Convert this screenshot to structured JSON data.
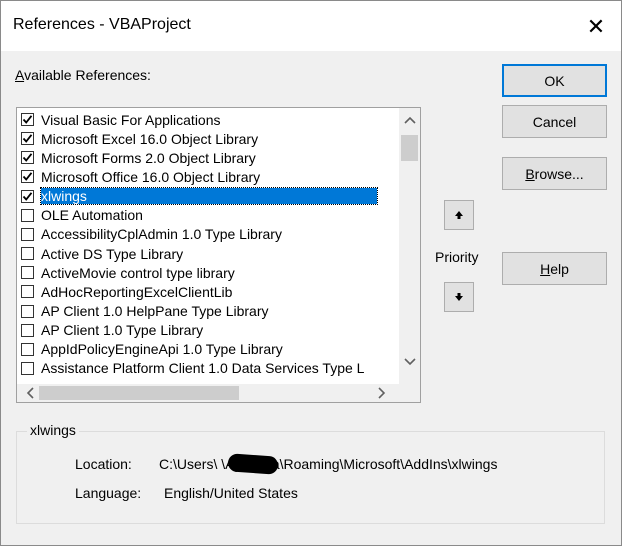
{
  "window": {
    "title": "References - VBAProject",
    "close_glyph": "✕"
  },
  "available_label": {
    "underlined": "A",
    "rest": "vailable References:"
  },
  "references": [
    {
      "label": "Visual Basic For Applications",
      "checked": true,
      "selected": false
    },
    {
      "label": "Microsoft Excel 16.0 Object Library",
      "checked": true,
      "selected": false
    },
    {
      "label": "Microsoft Forms 2.0 Object Library",
      "checked": true,
      "selected": false
    },
    {
      "label": "Microsoft Office 16.0 Object Library",
      "checked": true,
      "selected": false
    },
    {
      "label": "xlwings",
      "checked": true,
      "selected": true
    },
    {
      "label": "OLE Automation",
      "checked": false,
      "selected": false
    },
    {
      "label": "AccessibilityCplAdmin 1.0 Type Library",
      "checked": false,
      "selected": false
    },
    {
      "label": "Active DS Type Library",
      "checked": false,
      "selected": false
    },
    {
      "label": "ActiveMovie control type library",
      "checked": false,
      "selected": false
    },
    {
      "label": "AdHocReportingExcelClientLib",
      "checked": false,
      "selected": false
    },
    {
      "label": "AP Client 1.0 HelpPane Type Library",
      "checked": false,
      "selected": false
    },
    {
      "label": "AP Client 1.0 Type Library",
      "checked": false,
      "selected": false
    },
    {
      "label": "AppIdPolicyEngineApi 1.0 Type Library",
      "checked": false,
      "selected": false
    },
    {
      "label": "Assistance Platform Client 1.0 Data Services Type L",
      "checked": false,
      "selected": false
    }
  ],
  "buttons": {
    "ok": "OK",
    "cancel": "Cancel",
    "browse": {
      "underlined": "B",
      "rest": "rowse..."
    },
    "help": {
      "underlined": "H",
      "rest": "elp"
    }
  },
  "priority": {
    "label": "Priority",
    "up_icon": "arrow-up",
    "down_icon": "arrow-down"
  },
  "details": {
    "group_title": "xlwings",
    "location_label": "Location:",
    "location_value": "C:\\Users\\          \\AppData\\Roaming\\Microsoft\\AddIns\\xlwings",
    "language_label": "Language:",
    "language_value": "English/United States"
  }
}
